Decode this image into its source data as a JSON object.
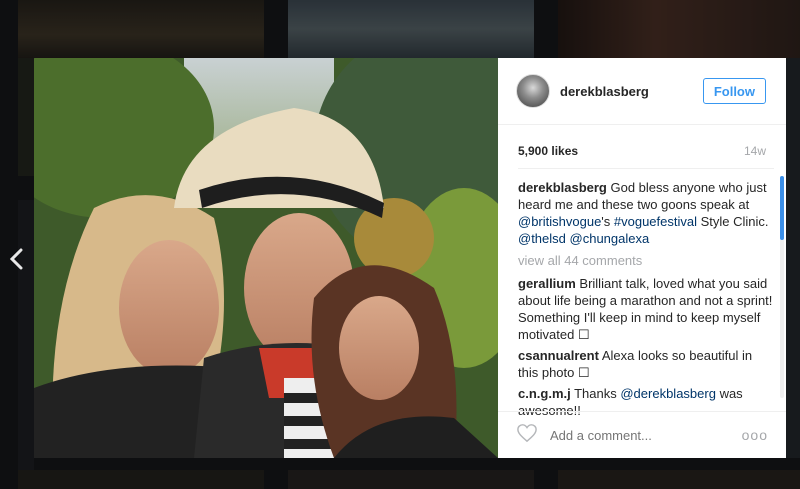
{
  "post": {
    "username": "derekblasberg",
    "follow_label": "Follow",
    "likes": "5,900 likes",
    "time_ago": "14w",
    "caption": {
      "user": "derekblasberg",
      "text1": " God bless anyone who just heard me and these two goons speak at ",
      "mention1": "@britishvogue",
      "text2": "'s ",
      "hashtag": "#voguefestival",
      "text3": " Style Clinic. ",
      "mention2": "@thelsd",
      "text4": " ",
      "mention3": "@chungalexa"
    },
    "view_all": "view all 44 comments",
    "comments": [
      {
        "user": "gerallium",
        "text": " Brilliant talk, loved what you said about life being a marathon and not a sprint! Something I'll keep in mind to keep myself motivated ☐"
      },
      {
        "user": "csannualrent",
        "text": " Alexa looks so beautiful in this photo ☐"
      },
      {
        "user": "c.n.g.m.j",
        "text_before": " Thanks ",
        "mention": "@derekblasberg",
        "text_after": " was awesome!!"
      }
    ],
    "comment_placeholder": "Add a comment...",
    "more_label": "ooo"
  },
  "icons": {
    "nav_prev": "chevron-left-icon",
    "like": "heart-icon",
    "options": "more-options-icon"
  },
  "colors": {
    "accent": "#3897f0",
    "link": "#003569",
    "muted": "#a5a7aa",
    "text": "#262626"
  }
}
